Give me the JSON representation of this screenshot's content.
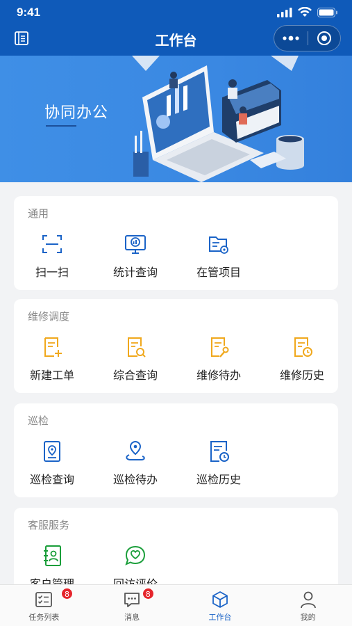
{
  "status_bar": {
    "time": "9:41"
  },
  "nav": {
    "title": "工作台"
  },
  "banner": {
    "title": "协同办公"
  },
  "sections": [
    {
      "title": "通用",
      "items": [
        {
          "label": "扫一扫",
          "icon": "scan-icon"
        },
        {
          "label": "统计查询",
          "icon": "statistics-monitor-icon"
        },
        {
          "label": "在管项目",
          "icon": "project-folder-icon"
        }
      ]
    },
    {
      "title": "维修调度",
      "items": [
        {
          "label": "新建工单",
          "icon": "new-order-icon"
        },
        {
          "label": "综合查询",
          "icon": "document-search-icon"
        },
        {
          "label": "维修待办",
          "icon": "repair-todo-icon"
        },
        {
          "label": "维修历史",
          "icon": "repair-history-icon"
        }
      ]
    },
    {
      "title": "巡检",
      "items": [
        {
          "label": "巡检查询",
          "icon": "location-card-icon"
        },
        {
          "label": "巡检待办",
          "icon": "location-route-icon"
        },
        {
          "label": "巡检历史",
          "icon": "inspection-history-icon"
        }
      ]
    },
    {
      "title": "客服服务",
      "items": [
        {
          "label": "客户管理",
          "icon": "contact-book-icon"
        },
        {
          "label": "回访评价",
          "icon": "heart-chat-icon"
        }
      ]
    }
  ],
  "tabbar": {
    "items": [
      {
        "label": "任务列表",
        "icon": "task-list-icon",
        "badge": "8"
      },
      {
        "label": "消息",
        "icon": "message-icon",
        "badge": "8"
      },
      {
        "label": "工作台",
        "icon": "workbench-cube-icon",
        "active": true
      },
      {
        "label": "我的",
        "icon": "user-icon"
      }
    ]
  },
  "colors": {
    "primary": "#0f5ab9",
    "banner": "#3a88e2",
    "icon_blue": "#1a63c7",
    "icon_orange": "#f0a81c",
    "icon_green": "#1a9e3a",
    "badge": "#e5252c",
    "background": "#f2f3f5"
  }
}
